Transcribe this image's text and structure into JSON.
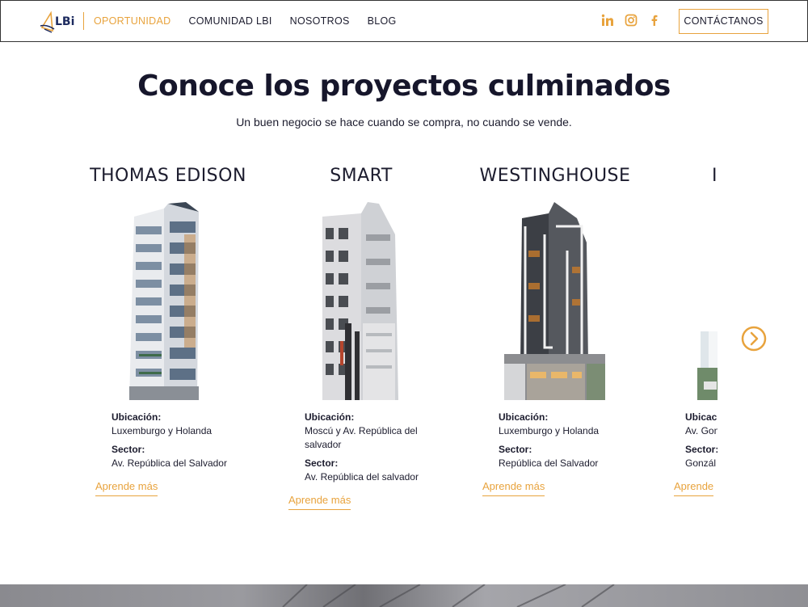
{
  "header": {
    "logo_text": "LBi",
    "nav": [
      {
        "label": "OPORTUNIDAD",
        "active": true
      },
      {
        "label": "COMUNIDAD LBI",
        "active": false
      },
      {
        "label": "NOSOTROS",
        "active": false
      },
      {
        "label": "BLOG",
        "active": false
      }
    ],
    "social": [
      "linkedin-icon",
      "instagram-icon",
      "facebook-icon"
    ],
    "contact_label": "CONTÁCTANOS"
  },
  "hero": {
    "title": "Conoce los proyectos culminados",
    "subtitle": "Un buen negocio se hace cuando se compra, no cuando se vende."
  },
  "projects": [
    {
      "name": "THOMAS EDISON",
      "ubicacion_label": "Ubicación:",
      "ubicacion": "Luxemburgo y Holanda",
      "sector_label": "Sector:",
      "sector": "Av. República del Salvador",
      "cta": "Aprende más"
    },
    {
      "name": "SMART",
      "ubicacion_label": "Ubicación:",
      "ubicacion_line1": "Moscú y Av. República del",
      "ubicacion_line2": "salvador",
      "sector_label": "Sector:",
      "sector": "Av. República del salvador",
      "cta": "Aprende más"
    },
    {
      "name": "WESTINGHOUSE",
      "ubicacion_label": "Ubicación:",
      "ubicacion": "Luxemburgo y Holanda",
      "sector_label": "Sector:",
      "sector": "República del Salvador",
      "cta": "Aprende más"
    },
    {
      "name": "I",
      "ubicacion_label": "Ubicac",
      "ubicacion": "Av. Gon",
      "sector_label": "Sector:",
      "sector": "Gonzál",
      "cta": "Aprende"
    }
  ],
  "colors": {
    "accent": "#e8a33d",
    "text": "#1c1c2e"
  }
}
